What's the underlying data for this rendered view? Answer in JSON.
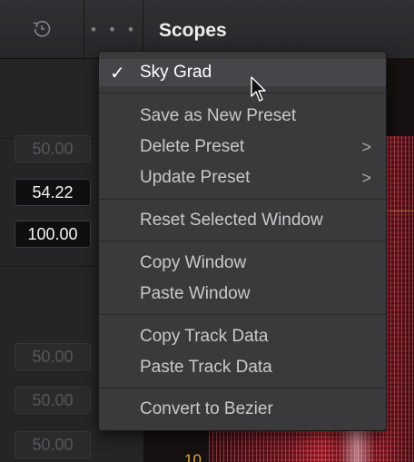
{
  "topbar": {
    "reset_icon": "reset-history-icon",
    "more_icon": "more-options-icon",
    "more_glyph": "• • •",
    "title": "Scopes"
  },
  "left_panel": {
    "fields": [
      "50.00",
      "54.22",
      "100.00",
      "50.00",
      "50.00",
      "50.00"
    ]
  },
  "scope": {
    "axis_label": "10"
  },
  "context_menu": {
    "items": [
      {
        "label": "Sky Grad",
        "checked": true,
        "check_glyph": "✓"
      },
      {
        "label": "Save as New Preset"
      },
      {
        "label": "Delete Preset",
        "submenu_glyph": ">"
      },
      {
        "label": "Update Preset",
        "submenu_glyph": ">"
      },
      {
        "label": "Reset Selected Window"
      },
      {
        "label": "Copy Window"
      },
      {
        "label": "Paste Window"
      },
      {
        "label": "Copy Track Data"
      },
      {
        "label": "Paste Track Data"
      },
      {
        "label": "Convert to Bezier"
      }
    ]
  },
  "cursor_icon": "mouse-pointer-icon",
  "colors": {
    "scope_accent": "#b32532",
    "grid_line": "#d8a83a",
    "menu_bg": "#3a3a3d"
  }
}
